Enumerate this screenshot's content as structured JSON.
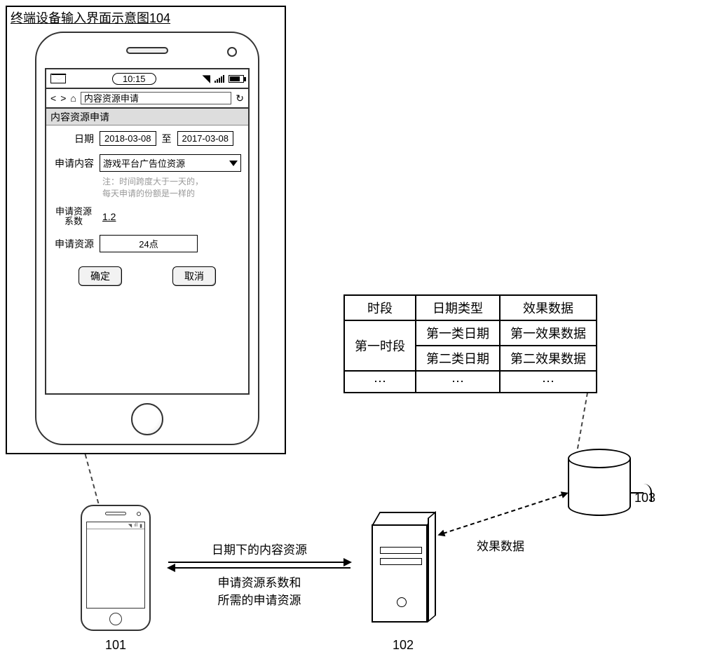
{
  "frame": {
    "title": "终端设备输入界面示意图104"
  },
  "statusbar": {
    "time": "10:15"
  },
  "navbar": {
    "address": "内容资源申请"
  },
  "page": {
    "heading": "内容资源申请",
    "date_label": "日期",
    "date_from": "2018-03-08",
    "date_to_word": "至",
    "date_to": "2017-03-08",
    "content_label": "申请内容",
    "content_value": "游戏平台广告位资源",
    "hint_line1": "注：时间跨度大于一天的，",
    "hint_line2": "每天申请的份额是一样的",
    "coeff_label_l1": "申请资源",
    "coeff_label_l2": "系数",
    "coeff_value": "1.2",
    "res_label": "申请资源",
    "res_value": "24点",
    "ok": "确定",
    "cancel": "取消"
  },
  "exchange": {
    "to_server": "日期下的内容资源",
    "to_phone_l1": "申请资源系数和",
    "to_phone_l2": "所需的申请资源"
  },
  "server_db_label": "效果数据",
  "table": {
    "h1": "时段",
    "h2": "日期类型",
    "h3": "效果数据",
    "r1c1": "第一时段",
    "r1c2": "第一类日期",
    "r1c3": "第一效果数据",
    "r2c2": "第二类日期",
    "r2c3": "第二效果数据",
    "dots": "⋯"
  },
  "refs": {
    "n101": "101",
    "n102": "102",
    "n103": "103"
  }
}
